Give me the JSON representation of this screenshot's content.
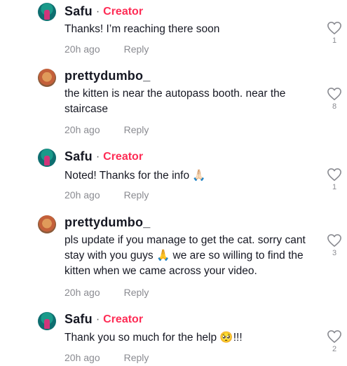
{
  "comments": [
    {
      "username": "Safu",
      "separator": "·",
      "creator_badge": "Creator",
      "text": "Thanks! I’m reaching there soon",
      "time": "20h ago",
      "reply": "Reply",
      "likes": "1",
      "avatar": "safu"
    },
    {
      "username": "prettydumbo_",
      "text": "the kitten is near the autopass booth. near the staircase",
      "time": "20h ago",
      "reply": "Reply",
      "likes": "8",
      "avatar": "prettydumbo"
    },
    {
      "username": "Safu",
      "separator": "·",
      "creator_badge": "Creator",
      "text": "Noted! Thanks for the info 🙏🏻",
      "time": "20h ago",
      "reply": "Reply",
      "likes": "1",
      "avatar": "safu"
    },
    {
      "username": "prettydumbo_",
      "text": "pls update if you manage to get the cat. sorry cant stay with you guys 🙏 we are so willing to find the kitten when we came across your video.",
      "time": "20h ago",
      "reply": "Reply",
      "likes": "3",
      "avatar": "prettydumbo"
    },
    {
      "username": "Safu",
      "separator": "·",
      "creator_badge": "Creator",
      "text": "Thank you so much for the help 🥺!!!",
      "time": "20h ago",
      "reply": "Reply",
      "likes": "2",
      "avatar": "safu"
    }
  ],
  "colors": {
    "creator": "#fe2c55",
    "meta": "#8a8b91",
    "text": "#161823"
  },
  "icons": {
    "like": "heart-outline-icon"
  }
}
